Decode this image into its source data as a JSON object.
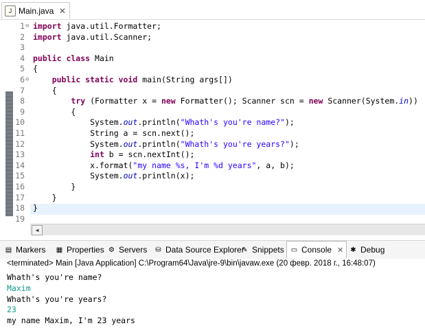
{
  "editor_tab": {
    "filename": "Main.java",
    "icon_label": "J",
    "close": "✕"
  },
  "lines": [
    {
      "n": "1",
      "fold": "⊖"
    },
    {
      "n": "2"
    },
    {
      "n": "3"
    },
    {
      "n": "4"
    },
    {
      "n": "5"
    },
    {
      "n": "6",
      "fold": "⊖"
    },
    {
      "n": "7"
    },
    {
      "n": "8"
    },
    {
      "n": "9"
    },
    {
      "n": "10"
    },
    {
      "n": "11"
    },
    {
      "n": "12"
    },
    {
      "n": "13"
    },
    {
      "n": "14"
    },
    {
      "n": "15"
    },
    {
      "n": "16"
    },
    {
      "n": "17"
    },
    {
      "n": "18"
    },
    {
      "n": "19"
    }
  ],
  "code": [
    [
      [
        "kw",
        "import"
      ],
      [
        "",
        "java.util.Formatter;"
      ]
    ],
    [
      [
        "kw",
        "import"
      ],
      [
        "",
        "java.util.Scanner;"
      ]
    ],
    [],
    [
      [
        "kw",
        "public class"
      ],
      [
        "",
        "Main"
      ]
    ],
    [
      [
        "",
        "{"
      ]
    ],
    [
      [
        "",
        "    "
      ],
      [
        "kw",
        "public static void"
      ],
      [
        "",
        "main(String args[])"
      ]
    ],
    [
      [
        "",
        "    {"
      ]
    ],
    [
      [
        "",
        "        "
      ],
      [
        "kw",
        "try"
      ],
      [
        "",
        " (Formatter x = "
      ],
      [
        "kw",
        "new"
      ],
      [
        "",
        " Formatter(); Scanner scn = "
      ],
      [
        "kw",
        "new"
      ],
      [
        "",
        " Scanner(System."
      ],
      [
        "it",
        "in"
      ],
      [
        "",
        "))"
      ]
    ],
    [
      [
        "",
        "        {"
      ]
    ],
    [
      [
        "",
        "            System."
      ],
      [
        "it",
        "out"
      ],
      [
        "",
        ".println("
      ],
      [
        "str",
        "\"Whath's you're name?\""
      ],
      [
        "",
        ");"
      ]
    ],
    [
      [
        "",
        "            String a = scn.next();"
      ]
    ],
    [
      [
        "",
        "            System."
      ],
      [
        "it",
        "out"
      ],
      [
        "",
        ".println("
      ],
      [
        "str",
        "\"Whath's you're years?\""
      ],
      [
        "",
        ");"
      ]
    ],
    [
      [
        "",
        "            "
      ],
      [
        "kw",
        "int"
      ],
      [
        "",
        " b = scn.nextInt();"
      ]
    ],
    [
      [
        "",
        "            x.format("
      ],
      [
        "str",
        "\"my name %s, I'm %d years\""
      ],
      [
        "",
        ", a, b);"
      ]
    ],
    [
      [
        "",
        "            System."
      ],
      [
        "it",
        "out"
      ],
      [
        "",
        ".println(x);"
      ]
    ],
    [
      [
        "",
        "        }"
      ]
    ],
    [
      [
        "",
        "    }"
      ]
    ],
    [
      [
        "",
        "}"
      ]
    ],
    []
  ],
  "views": [
    {
      "label": "Markers",
      "icon": "▤",
      "name": "markers-tab",
      "icon_name": "markers-icon"
    },
    {
      "label": "Properties",
      "icon": "▦",
      "name": "properties-tab",
      "icon_name": "properties-icon"
    },
    {
      "label": "Servers",
      "icon": "⚙",
      "name": "servers-tab",
      "icon_name": "servers-icon"
    },
    {
      "label": "Data Source Explorer",
      "icon": "⛁",
      "name": "data-source-explorer-tab",
      "icon_name": "database-icon"
    },
    {
      "label": "Snippets",
      "icon": "✎",
      "name": "snippets-tab",
      "icon_name": "snippets-icon"
    },
    {
      "label": "Console",
      "icon": "▭",
      "name": "console-tab",
      "icon_name": "console-icon",
      "close": "✕",
      "active": true
    },
    {
      "label": "Debug",
      "icon": "✱",
      "name": "debug-tab",
      "icon_name": "debug-icon"
    }
  ],
  "console": {
    "terminated": "<terminated> Main [Java Application] C:\\Program64\\Java\\jre-9\\bin\\javaw.exe (20 февр. 2018 г., 16:48:07)",
    "output": [
      {
        "text": "Whath's you're name?",
        "input": false
      },
      {
        "text": "Maxim",
        "input": true
      },
      {
        "text": "Whath's you're years?",
        "input": false
      },
      {
        "text": "23",
        "input": true
      },
      {
        "text": "my name Maxim, I'm 23 years",
        "input": false
      }
    ]
  },
  "colors": {
    "keyword": "#7f0055",
    "string": "#2a00ff",
    "field": "#0000c0",
    "console_input": "#0f9a8a"
  }
}
